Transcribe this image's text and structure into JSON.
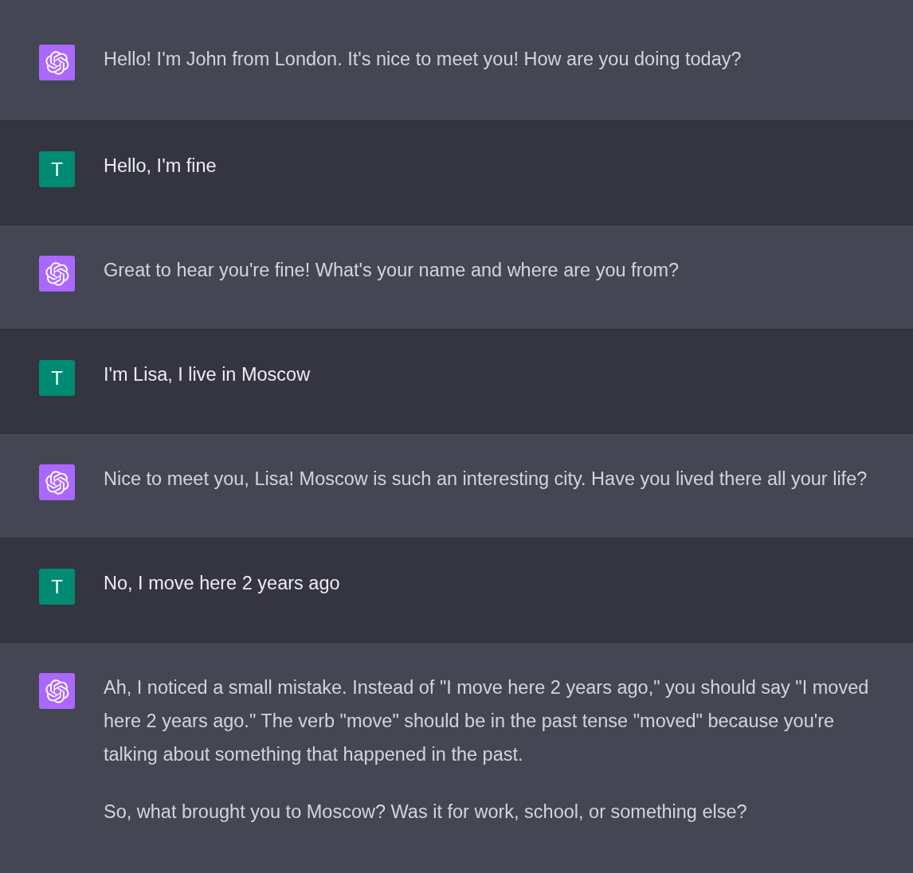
{
  "messages": [
    {
      "kind": "assistant",
      "paragraphs": [
        "Hello! I'm John from London. It's nice to meet you! How are you doing today?"
      ]
    },
    {
      "kind": "user",
      "avatar_letter": "T",
      "paragraphs": [
        "Hello, I'm fine"
      ]
    },
    {
      "kind": "assistant",
      "paragraphs": [
        "Great to hear you're fine! What's your name and where are you from?"
      ]
    },
    {
      "kind": "user",
      "avatar_letter": "T",
      "paragraphs": [
        "I'm Lisa, I live in Moscow"
      ]
    },
    {
      "kind": "assistant",
      "paragraphs": [
        "Nice to meet you, Lisa! Moscow is such an interesting city. Have you lived there all your life?"
      ]
    },
    {
      "kind": "user",
      "avatar_letter": "T",
      "paragraphs": [
        "No, I move here 2 years ago"
      ]
    },
    {
      "kind": "assistant",
      "paragraphs": [
        "Ah, I noticed a small mistake. Instead of \"I move here 2 years ago,\" you should say \"I moved here 2 years ago.\" The verb \"move\" should be in the past tense \"moved\" because you're talking about something that happened in the past.",
        "So, what brought you to Moscow? Was it for work, school, or something else?"
      ]
    }
  ]
}
